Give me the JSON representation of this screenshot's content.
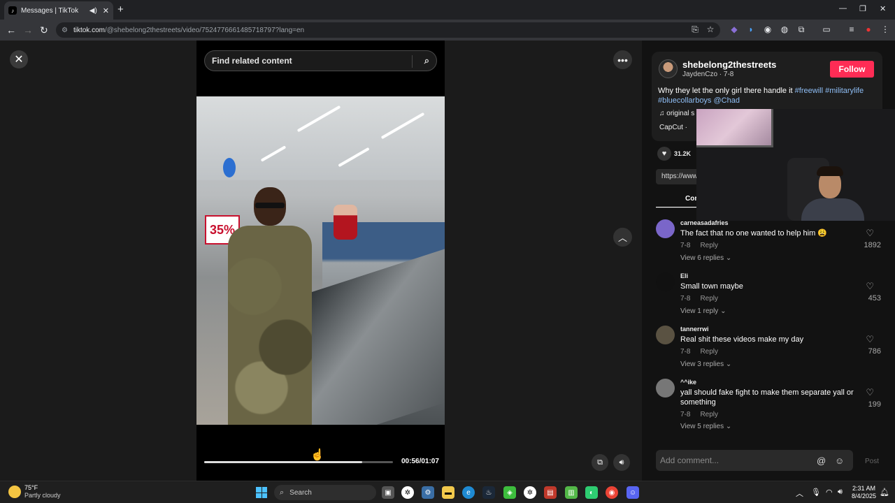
{
  "browser": {
    "tab_title": "Messages | TikTok",
    "tab_favicon": "♪",
    "url_domain": "tiktok.com",
    "url_path": "/@shebelong2thestreets/video/7524776661485718797?lang=en"
  },
  "player": {
    "search_placeholder": "Find related content",
    "time": "00:56/01:07",
    "progress": 0.836,
    "sign_text": "35%"
  },
  "author": {
    "username": "shebelong2thestreets",
    "subname": "JaydenCzo · 7-8",
    "follow_label": "Follow",
    "caption_text": "Why they let the only girl there handle it ",
    "caption_tags": [
      "#freewill",
      "#militarylife",
      "#bluecollarboys",
      "@Chad"
    ],
    "music": "♫  original s",
    "capcut": "CapCut · ",
    "like_count": "31.2K",
    "link_text": "https://www",
    "comments_tab": "Cor"
  },
  "comments": [
    {
      "user": "carneasadafries",
      "text": "The fact that no one wanted to help him 😩",
      "date": "7-8",
      "reply": "Reply",
      "replies": "View 6 replies ⌄",
      "likes": "1892",
      "avatar_color": "#7a66c9"
    },
    {
      "user": "Eli",
      "text": "Small town maybe",
      "date": "7-8",
      "reply": "Reply",
      "replies": "View 1 reply ⌄",
      "likes": "453",
      "avatar_color": "#111111"
    },
    {
      "user": "tannerrwi",
      "text": "Real shit these videos make my day",
      "date": "7-8",
      "reply": "Reply",
      "replies": "View 3 replies ⌄",
      "likes": "786",
      "avatar_color": "#5a5242"
    },
    {
      "user": "^^ike",
      "text": "yall should fake fight to make them separate yall or something",
      "date": "7-8",
      "reply": "Reply",
      "replies": "View 5 replies ⌄",
      "likes": "199",
      "avatar_color": "#777777"
    }
  ],
  "comment_input": {
    "placeholder": "Add comment...",
    "post_label": "Post"
  },
  "taskbar": {
    "temp": "75°F",
    "weather": "Partly cloudy",
    "search_label": "Search",
    "time": "2:31 AM",
    "date": "8/4/2025"
  },
  "colors": {
    "accent": "#fe2c55",
    "hashtag": "#8fbef5"
  }
}
